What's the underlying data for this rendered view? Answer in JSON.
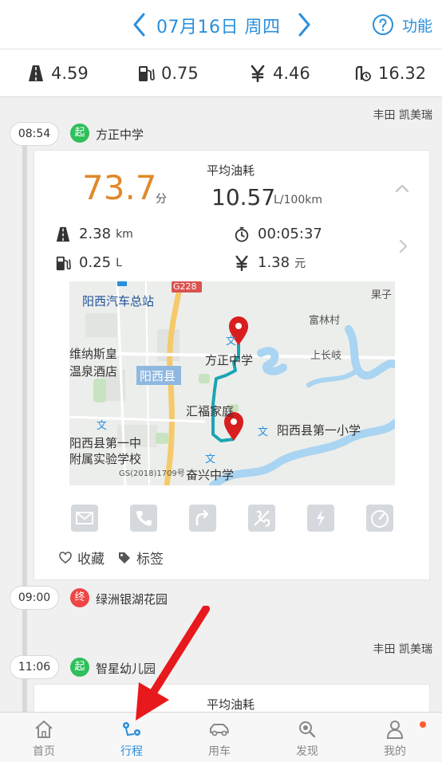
{
  "header": {
    "date": "07月16日 周四",
    "function_label": "功能"
  },
  "stats": {
    "distance": "4.59",
    "fuel": "0.75",
    "cost": "4.46",
    "avg": "16.32"
  },
  "trip1": {
    "car": "丰田 凯美瑞",
    "start_time": "08:54",
    "start_badge": "起",
    "start_place": "方正中学",
    "score": "73.7",
    "score_unit": "分",
    "fuel_title": "平均油耗",
    "fuel_value": "10.57",
    "fuel_unit": "L/100km",
    "distance": "2.38",
    "distance_unit": "km",
    "duration": "00:05:37",
    "fuel_used": "0.25",
    "fuel_used_unit": "L",
    "cost": "1.38",
    "cost_unit": "元",
    "end_time": "09:00",
    "end_badge": "终",
    "end_place": "绿洲银湖花园",
    "fav_label": "收藏",
    "tag_label": "标签"
  },
  "map": {
    "labels": {
      "bus_station": "阳西汽车总站",
      "g228": "G228",
      "guozi": "果子",
      "fulin": "富林村",
      "weinasi": "维纳斯皇",
      "wenquan": "温泉酒店",
      "fangzheng": "方正中学",
      "shangchangqi": "上长岐",
      "county": "阳西县",
      "huifu": "汇福家庭",
      "no1_primary": "阳西县第一小学",
      "no1_middle_a": "阳西县第一中",
      "no1_middle_b": "附属实验学校",
      "fenxing": "奋兴中学",
      "copyright": "GS(2018)1709号",
      "wen1": "文",
      "wen2": "文",
      "wen3": "文",
      "wen4": "文"
    }
  },
  "trip2": {
    "car": "丰田 凯美瑞",
    "start_time": "11:06",
    "start_badge": "起",
    "start_place": "智星幼儿园",
    "fuel_title": "平均油耗"
  },
  "nav": {
    "items": [
      {
        "label": "首页"
      },
      {
        "label": "行程"
      },
      {
        "label": "用车"
      },
      {
        "label": "发现"
      },
      {
        "label": "我的"
      }
    ]
  },
  "colors": {
    "accent": "#2a8fdc",
    "score": "#e0892a",
    "start": "#2fbf5b",
    "end": "#f04545",
    "route": "#1aa5b5",
    "arrow": "#e8191c"
  }
}
